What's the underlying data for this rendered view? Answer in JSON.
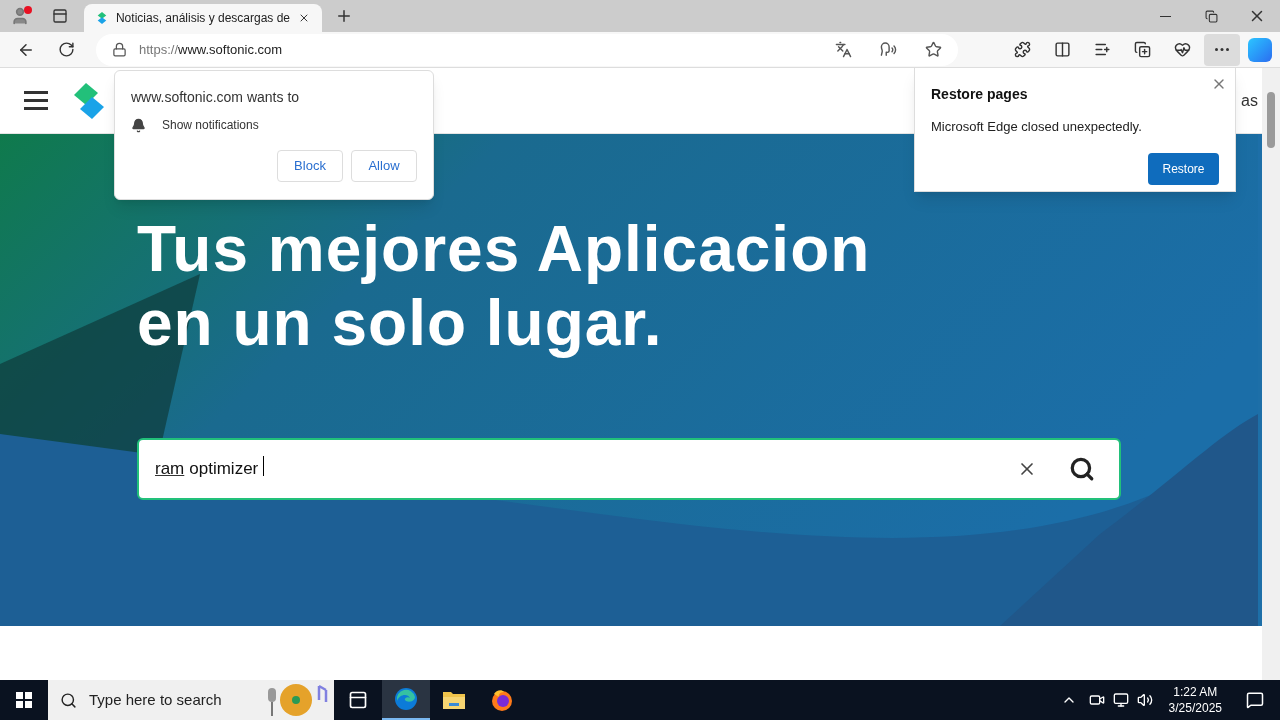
{
  "browser": {
    "tabs": [
      {
        "title": "Noticias, análisis y descargas de",
        "selected": true
      }
    ],
    "address": {
      "scheme": "https://",
      "host": "www.softonic.com"
    },
    "more_menu_pressed": true
  },
  "site": {
    "header_text": "as",
    "hero": {
      "lines": [
        "Tus mejores Aplicacion",
        "en un solo lugar."
      ],
      "search": {
        "words": [
          {
            "text": "ram",
            "spelling_flag": true
          },
          {
            "text": "optimizer",
            "spelling_flag": false
          }
        ]
      }
    }
  },
  "notification_prompt": {
    "origin": "www.softonic.com wants to",
    "permission": "Show notifications",
    "buttons": [
      "Block",
      "Allow"
    ]
  },
  "restore_prompt": {
    "title": "Restore pages",
    "message": "Microsoft Edge closed unexpectedly.",
    "button": "Restore"
  },
  "taskbar": {
    "search_placeholder": "Type here to search",
    "apps": [
      {
        "kind": "task-view",
        "active": false
      },
      {
        "kind": "edge",
        "active": true
      },
      {
        "kind": "file-explorer",
        "active": false
      },
      {
        "kind": "firefox",
        "active": false
      }
    ],
    "time": "1:22 AM",
    "date": "3/25/2025"
  }
}
